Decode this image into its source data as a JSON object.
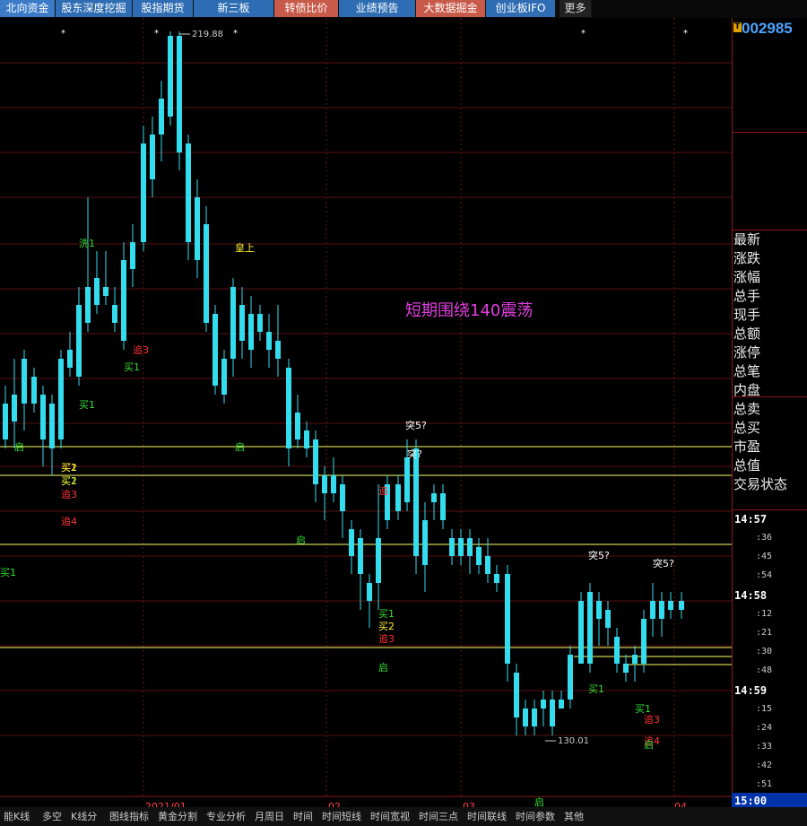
{
  "topbar": {
    "tabs": [
      "北向资金",
      "股东深度挖掘",
      "股指期货",
      "新三板",
      "转债比价",
      "业绩预告",
      "大数据掘金",
      "创业板IFO",
      "更多"
    ]
  },
  "chart": {
    "annotation": "短期围绕140震荡",
    "high_label": "219.88",
    "low_label": "130.01",
    "axis_months": [
      "2021/01",
      "02",
      "03",
      "04"
    ],
    "signals": [
      {
        "t": "洗1",
        "c": "#33dd33"
      },
      {
        "t": "皇上",
        "c": "#ffee33"
      },
      {
        "t": "追3",
        "c": "#ff3333"
      },
      {
        "t": "买1",
        "c": "#33dd33"
      },
      {
        "t": "买1",
        "c": "#33dd33"
      },
      {
        "t": "买2",
        "c": "#ffee33"
      },
      {
        "t": "买1",
        "c": "#33dd33"
      },
      {
        "t": "启",
        "c": "#33dd33"
      },
      {
        "t": "买1",
        "c": "#ffee33"
      },
      {
        "t": "买2",
        "c": "#ffee33"
      },
      {
        "t": "追3",
        "c": "#ff3333"
      },
      {
        "t": "追4",
        "c": "#ff3333"
      },
      {
        "t": "启",
        "c": "#33dd33"
      },
      {
        "t": "启",
        "c": "#33dd33"
      },
      {
        "t": "突5?",
        "c": "#ffffff"
      },
      {
        "t": "突?",
        "c": "#ffffff"
      },
      {
        "t": "追",
        "c": "#ff3333"
      },
      {
        "t": "买1",
        "c": "#33dd33"
      },
      {
        "t": "买2",
        "c": "#ffee33"
      },
      {
        "t": "追3",
        "c": "#ff3333"
      },
      {
        "t": "启",
        "c": "#33dd33"
      },
      {
        "t": "突5?",
        "c": "#ffffff"
      },
      {
        "t": "突5?",
        "c": "#ffffff"
      },
      {
        "t": "买1",
        "c": "#33dd33"
      },
      {
        "t": "买1",
        "c": "#33dd33"
      },
      {
        "t": "追3",
        "c": "#ff3333"
      },
      {
        "t": "追4",
        "c": "#ff3333"
      },
      {
        "t": "启",
        "c": "#33dd33"
      },
      {
        "t": "启",
        "c": "#33dd33"
      },
      {
        "t": "买1",
        "c": "#33dd33"
      }
    ]
  },
  "right_panel": {
    "code": "002985",
    "flag": "T",
    "fields": [
      "最新",
      "涨跌",
      "涨幅",
      "总手",
      "现手",
      "总额",
      "涨停",
      "总笔",
      "内盘",
      "总卖",
      "总买",
      "市盈",
      "总值",
      "交易状态"
    ],
    "ticks": [
      {
        "time": "14:57",
        "secs": [
          ":36",
          ":45",
          ":54"
        ]
      },
      {
        "time": "14:58",
        "secs": [
          ":12",
          ":21",
          ":30",
          ":48"
        ]
      },
      {
        "time": "14:59",
        "secs": [
          ":15",
          ":24",
          ":33",
          ":42",
          ":51"
        ]
      }
    ],
    "final_time": "15:00"
  },
  "bottombar": {
    "tabs": [
      "能K线",
      "多空",
      "K线分",
      "图线指标",
      "黄金分割",
      "专业分析",
      "月周日",
      "时间",
      "时间短线",
      "时间宽视",
      "时间三点",
      "时间联线",
      "时间参数",
      "其他"
    ]
  },
  "colors": {
    "up": "#ff4444",
    "down": "#33ddee",
    "level": "#ffff66",
    "signal_buy": "#33dd33",
    "signal_sell": "#ff3333"
  }
}
